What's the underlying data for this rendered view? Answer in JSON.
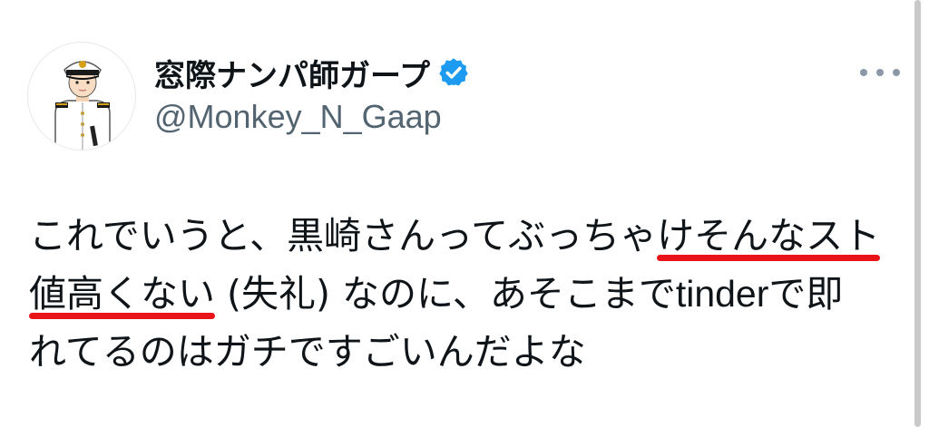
{
  "author": {
    "display_name": "窓際ナンパ師ガープ",
    "handle": "@Monkey_N_Gaap",
    "verified_badge": "verified-check-icon",
    "verified_color": "#1d9bf0"
  },
  "menu": {
    "icon": "more-options-icon"
  },
  "tweet": {
    "line1_plain": "これでいうと、黒崎さんってぶっちゃ",
    "line1_underlined": "けそんなスト",
    "line2_underlined": "値高くない",
    "line2_plain_a": " (失礼) なのに、あそこまで",
    "line2_latin": "tinder",
    "line2_plain_b": "で即",
    "line3": "れてるのはガチですごいんだよな",
    "underline_color": "#e8141a"
  }
}
